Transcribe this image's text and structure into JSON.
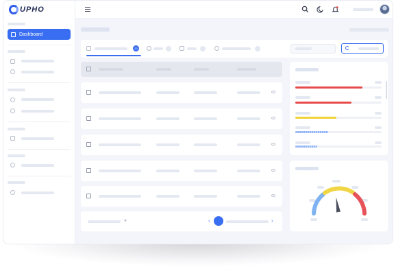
{
  "app": {
    "logo_text": "UPHO"
  },
  "sidebar": {
    "active_item": {
      "label": "Dashboard",
      "icon": "grid-icon"
    }
  },
  "colors": {
    "accent": "#3a6ef2",
    "red": "#e84a4a",
    "yellow": "#f2d233",
    "blue_light": "#8fb3f5",
    "gauge_blue": "#7fb2f0",
    "gauge_yellow": "#f0d545",
    "gauge_red": "#e8535a"
  },
  "tabs": {
    "badge": "20"
  },
  "progress": {
    "bars": [
      0.78,
      0.65,
      0.48,
      0.38,
      0.25
    ]
  },
  "gauge": {
    "needle_fraction": 0.45
  }
}
